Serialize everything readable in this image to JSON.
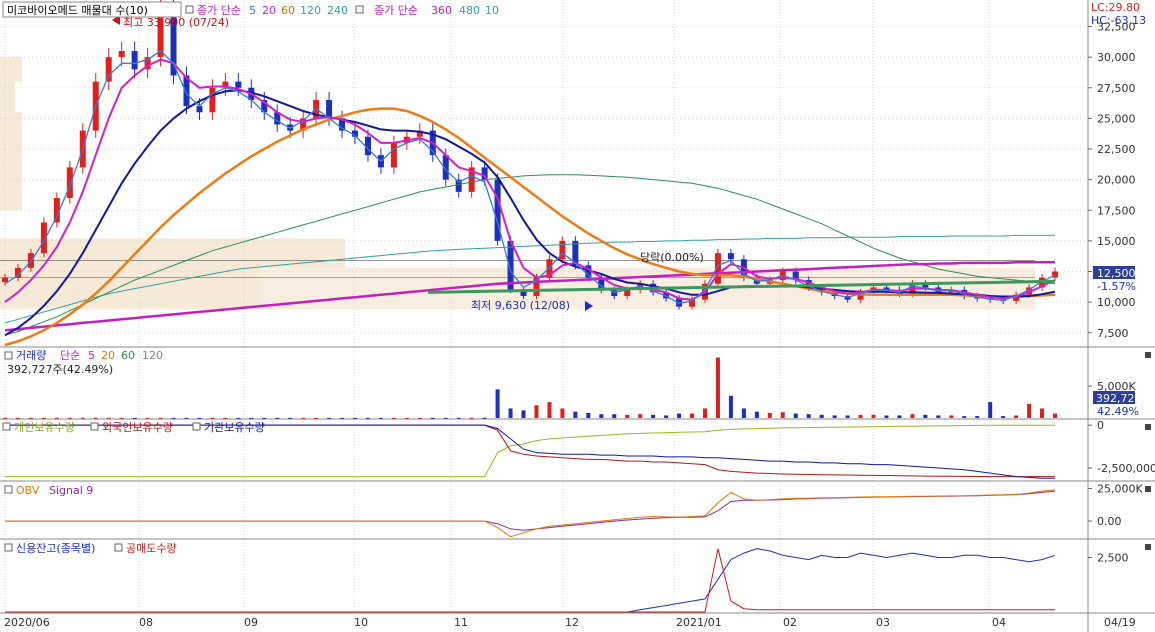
{
  "colors": {
    "up": "#e0201c",
    "down": "#1c2fbf",
    "ma5": "#3d78d8",
    "ma20": "#d41fc9",
    "ma60": "#12169e",
    "ma120": "#f07a15",
    "ma240": "#2c8d52",
    "ma360": "#c31ec2",
    "ma480": "#2fa0a3",
    "volume_band": "#f6e9d6",
    "grid": "#d8d8d8",
    "value_box": "#2c3e9a"
  },
  "header": {
    "stock_title": "미코바이오메드 매물대 수(10)",
    "ma_prefix": "종가 단순",
    "ma_periods": [
      "5",
      "20",
      "60",
      "120",
      "240"
    ],
    "ma2_prefix": "종가 단순",
    "ma2_periods": [
      "360",
      "480",
      "10"
    ]
  },
  "panels": {
    "price": {
      "lc_label": "LC:29.80",
      "hc_label": "HC:-63.13",
      "current_value": "12,500",
      "current_change": "-1.57%",
      "high_annotation": "최고 33,900 (07/24)",
      "low_annotation": "최저 9,630 (12/08)",
      "percent_annotation": "당락(0.00%)",
      "y_ticks": [
        "32,500",
        "30,000",
        "27,500",
        "25,000",
        "22,500",
        "20,000",
        "17,500",
        "15,000",
        "12,500",
        "10,000",
        "7,500"
      ]
    },
    "volume": {
      "title": "거래량",
      "ma_prefix": "단순",
      "ma_periods": [
        "5",
        "20",
        "60",
        "120"
      ],
      "last_value_text": "392,727주(42.49%)",
      "box_value": "392,727",
      "box_pct": "42.49%",
      "y_ticks": [
        "5,000K"
      ]
    },
    "holders": {
      "series": [
        "개인보유수량",
        "외국인보유수량",
        "기관보유수량"
      ],
      "y_ticks": [
        "0",
        "-2,500,000"
      ]
    },
    "obv": {
      "series": [
        "OBV",
        "Signal 9"
      ],
      "y_ticks": [
        "25,000K",
        "0.00"
      ]
    },
    "credit": {
      "series": [
        "신용잔고(종목별)",
        "공매도수량"
      ],
      "y_ticks": [
        "2,500"
      ]
    }
  },
  "x_axis": {
    "labels": [
      "2020/06",
      "08",
      "09",
      "10",
      "11",
      "12",
      "2021/01",
      "02",
      "03",
      "04",
      "04/19"
    ]
  },
  "chart_data": {
    "type": "candlestick",
    "x_range": [
      "2020/06",
      "2021/04/19"
    ],
    "price_ylim": [
      6500,
      34500
    ],
    "price_close": [
      12000,
      12800,
      14000,
      16500,
      18500,
      21000,
      24000,
      28000,
      30000,
      30500,
      29000,
      30000,
      33900,
      28500,
      26000,
      25500,
      27500,
      28000,
      27500,
      26500,
      25500,
      24500,
      24000,
      25000,
      26500,
      25000,
      24000,
      23500,
      22000,
      21000,
      23000,
      23500,
      24000,
      22000,
      20000,
      19000,
      21000,
      20000,
      15000,
      11000,
      10500,
      12000,
      13500,
      15000,
      13000,
      12000,
      11000,
      10500,
      11000,
      11500,
      10800,
      10300,
      9630,
      10200,
      11500,
      14000,
      13500,
      12000,
      11500,
      11800,
      12500,
      11800,
      11200,
      10800,
      10500,
      10200,
      10800,
      11200,
      11000,
      10700,
      11500,
      11200,
      10800,
      11000,
      10500,
      10300,
      10200,
      10100,
      10600,
      11200,
      12000,
      12500
    ],
    "ma5": [
      11500,
      12200,
      13300,
      15000,
      17000,
      19500,
      22500,
      26000,
      28500,
      29500,
      29500,
      29800,
      30500,
      29500,
      27000,
      26000,
      27000,
      27500,
      27200,
      26500,
      25500,
      24800,
      24200,
      24800,
      25800,
      25000,
      24200,
      23600,
      22500,
      21500,
      22500,
      23000,
      23300,
      22300,
      20800,
      19800,
      20300,
      19800,
      16500,
      12500,
      11200,
      11800,
      12800,
      14000,
      13200,
      12200,
      11300,
      10800,
      11000,
      11300,
      10900,
      10500,
      9900,
      10100,
      11000,
      13000,
      13400,
      12300,
      11700,
      11800,
      12200,
      11800,
      11300,
      10900,
      10600,
      10400,
      10700,
      11000,
      10950,
      10800,
      11300,
      11150,
      10900,
      10950,
      10650,
      10400,
      10250,
      10150,
      10500,
      11000,
      11700,
      12200
    ],
    "ma20": [
      10000,
      10800,
      11800,
      13000,
      14500,
      16500,
      19000,
      22000,
      25000,
      27500,
      28500,
      29300,
      29800,
      29500,
      28300,
      27500,
      27600,
      27600,
      27400,
      27000,
      26300,
      25500,
      24900,
      24700,
      25000,
      25100,
      24900,
      24500,
      23800,
      23000,
      23000,
      23200,
      23400,
      23000,
      22000,
      21000,
      20700,
      20300,
      18500,
      15000,
      12800,
      12000,
      12200,
      13000,
      13200,
      12700,
      12000,
      11400,
      11100,
      11200,
      11000,
      10800,
      10300,
      10200,
      10800,
      12300,
      13100,
      12800,
      12100,
      11900,
      12000,
      11900,
      11600,
      11200,
      10900,
      10700,
      10800,
      11000,
      11000,
      10900,
      11100,
      11100,
      11000,
      10980,
      10800,
      10600,
      10400,
      10300,
      10450,
      10800,
      11300,
      11800
    ],
    "ma60": [
      7300,
      7900,
      8700,
      9700,
      10900,
      12300,
      14000,
      15900,
      17800,
      19700,
      21300,
      22700,
      24000,
      25000,
      25800,
      26400,
      26900,
      27200,
      27300,
      27100,
      26800,
      26400,
      26000,
      25600,
      25300,
      25100,
      24900,
      24700,
      24400,
      24100,
      24000,
      24000,
      23900,
      23700,
      23300,
      22700,
      22100,
      21400,
      20200,
      18500,
      16700,
      15100,
      14000,
      13300,
      12900,
      12600,
      12300,
      11900,
      11600,
      11500,
      11300,
      11100,
      10800,
      10600,
      10600,
      10900,
      11200,
      11300,
      11300,
      11300,
      11300,
      11300,
      11200,
      11100,
      11000,
      10900,
      10850,
      10850,
      10850,
      10800,
      10800,
      10780,
      10750,
      10700,
      10650,
      10600,
      10500,
      10450,
      10450,
      10500,
      10650,
      10850
    ],
    "ma120": [
      6500,
      6800,
      7200,
      7700,
      8300,
      9000,
      9800,
      10700,
      11700,
      12800,
      13900,
      15000,
      16100,
      17100,
      18000,
      18900,
      19700,
      20500,
      21200,
      21900,
      22500,
      23100,
      23600,
      24100,
      24500,
      24900,
      25200,
      25500,
      25700,
      25800,
      25800,
      25600,
      25200,
      24700,
      24100,
      23400,
      22600,
      21800,
      21000,
      20200,
      19400,
      18600,
      17800,
      17000,
      16300,
      15600,
      15000,
      14400,
      13900,
      13500,
      13100,
      12800,
      12500,
      12300,
      12200,
      12200,
      12200,
      12100,
      11900,
      11700,
      11500,
      11300,
      11100,
      10900,
      10800,
      10700,
      10650,
      10600,
      10600,
      10600,
      10600,
      10600,
      10600,
      10600,
      10550,
      10500,
      10450,
      10450,
      10450,
      10500,
      10550,
      10600
    ],
    "ma240": [
      7300,
      7600,
      8000,
      8400,
      8800,
      9300,
      9800,
      10300,
      10800,
      11300,
      11800,
      12200,
      12600,
      13000,
      13400,
      13800,
      14200,
      14500,
      14800,
      15100,
      15400,
      15700,
      16000,
      16300,
      16600,
      16900,
      17200,
      17500,
      17800,
      18100,
      18400,
      18700,
      19000,
      19200,
      19400,
      19600,
      19800,
      20000,
      20100,
      20200,
      20300,
      20350,
      20400,
      20400,
      20400,
      20350,
      20300,
      20250,
      20200,
      20100,
      20000,
      19900,
      19800,
      19700,
      19500,
      19300,
      19000,
      18700,
      18400,
      18000,
      17600,
      17200,
      16800,
      16400,
      15900,
      15400,
      14900,
      14400,
      14000,
      13600,
      13300,
      13000,
      12700,
      12500,
      12300,
      12100,
      12000,
      11900,
      11800,
      11700,
      11600,
      11500
    ],
    "ma360": [
      7700,
      7800,
      7900,
      8000,
      8100,
      8200,
      8300,
      8400,
      8500,
      8600,
      8700,
      8800,
      8900,
      9000,
      9100,
      9200,
      9300,
      9400,
      9500,
      9600,
      9700,
      9800,
      9900,
      10000,
      10100,
      10200,
      10300,
      10400,
      10500,
      10600,
      10700,
      10800,
      10900,
      11000,
      11100,
      11200,
      11300,
      11400,
      11500,
      11550,
      11600,
      11650,
      11700,
      11750,
      11800,
      11850,
      11900,
      11950,
      12000,
      12050,
      12100,
      12150,
      12200,
      12250,
      12300,
      12350,
      12400,
      12450,
      12500,
      12550,
      12600,
      12650,
      12700,
      12750,
      12800,
      12850,
      12900,
      12950,
      13000,
      13050,
      13100,
      13100,
      13150,
      13150,
      13200,
      13200,
      13200,
      13200,
      13250,
      13250,
      13250,
      13250
    ],
    "ma480": [
      8300,
      8600,
      8900,
      9200,
      9500,
      9800,
      10100,
      10400,
      10700,
      10900,
      11100,
      11300,
      11500,
      11700,
      11900,
      12100,
      12300,
      12500,
      12700,
      12800,
      12900,
      13000,
      13100,
      13200,
      13300,
      13400,
      13500,
      13600,
      13700,
      13800,
      13900,
      14000,
      14100,
      14200,
      14250,
      14300,
      14350,
      14400,
      14450,
      14500,
      14550,
      14600,
      14650,
      14700,
      14750,
      14800,
      14850,
      14900,
      14900,
      14950,
      14950,
      15000,
      15000,
      15050,
      15050,
      15100,
      15100,
      15150,
      15150,
      15200,
      15200,
      15200,
      15250,
      15250,
      15250,
      15300,
      15300,
      15300,
      15300,
      15350,
      15350,
      15350,
      15350,
      15400,
      15400,
      15400,
      15400,
      15400,
      15450,
      15450,
      15450,
      15450
    ],
    "volume_profile": [
      0,
      0,
      0,
      0,
      0,
      0,
      0,
      0,
      0,
      0
    ],
    "volume_k": [
      20,
      20,
      30,
      30,
      25,
      30,
      40,
      35,
      30,
      25,
      20,
      25,
      35,
      25,
      20,
      20,
      25,
      20,
      20,
      15,
      15,
      15,
      15,
      20,
      20,
      15,
      15,
      15,
      20,
      15,
      15,
      15,
      15,
      20,
      25,
      20,
      20,
      40,
      4500,
      1500,
      1200,
      2000,
      2500,
      1500,
      1000,
      800,
      600,
      600,
      500,
      600,
      500,
      400,
      700,
      700,
      1500,
      9500,
      3500,
      1500,
      1000,
      800,
      900,
      700,
      600,
      500,
      400,
      400,
      500,
      500,
      400,
      400,
      600,
      500,
      400,
      400,
      300,
      300,
      2500,
      300,
      400,
      2200,
      1500,
      700
    ],
    "volume_ylim": [
      0,
      11000
    ],
    "holders_individual": [
      -3000000,
      -3000000,
      -3000000,
      -3000000,
      -3000000,
      -3000000,
      -3000000,
      -3000000,
      -3000000,
      -3000000,
      -3000000,
      -3000000,
      -3000000,
      -3000000,
      -3000000,
      -3000000,
      -3000000,
      -3000000,
      -3000000,
      -3000000,
      -3000000,
      -3000000,
      -3000000,
      -3000000,
      -3000000,
      -3000000,
      -3000000,
      -3000000,
      -3000000,
      -3000000,
      -3000000,
      -3000000,
      -3000000,
      -3000000,
      -3000000,
      -3000000,
      -3000000,
      -3000000,
      -1600000,
      -1200000,
      -1100000,
      -900000,
      -800000,
      -750000,
      -700000,
      -650000,
      -600000,
      -550000,
      -500000,
      -480000,
      -460000,
      -440000,
      -420000,
      -400000,
      -380000,
      -300000,
      -250000,
      -220000,
      -200000,
      -180000,
      -160000,
      -150000,
      -140000,
      -130000,
      -120000,
      -110000,
      -100000,
      -90000,
      -80000,
      -70000,
      -60000,
      -50000,
      -40000,
      -30000,
      -20000,
      -15000,
      -10000,
      -8000,
      -6000,
      -4000,
      -2000,
      -1000
    ],
    "holders_foreign": [
      0,
      0,
      0,
      0,
      0,
      0,
      0,
      0,
      0,
      0,
      0,
      0,
      0,
      0,
      0,
      0,
      0,
      0,
      0,
      0,
      0,
      0,
      0,
      0,
      0,
      0,
      0,
      0,
      0,
      0,
      0,
      0,
      0,
      0,
      0,
      0,
      0,
      0,
      -300000,
      -1500000,
      -1700000,
      -1800000,
      -1850000,
      -1900000,
      -1950000,
      -2000000,
      -2000000,
      -2050000,
      -2100000,
      -2100000,
      -2150000,
      -2150000,
      -2200000,
      -2250000,
      -2300000,
      -2600000,
      -2700000,
      -2750000,
      -2800000,
      -2820000,
      -2850000,
      -2870000,
      -2880000,
      -2890000,
      -2900000,
      -2910000,
      -2920000,
      -2930000,
      -2940000,
      -2950000,
      -2960000,
      -2970000,
      -2980000,
      -2985000,
      -2990000,
      -2995000,
      -3000000,
      -3000000,
      -3000000,
      -3000000,
      -3000000,
      -3000000
    ],
    "holders_institution": [
      0,
      0,
      0,
      0,
      0,
      0,
      0,
      0,
      0,
      0,
      0,
      0,
      0,
      0,
      0,
      0,
      0,
      0,
      0,
      0,
      0,
      0,
      0,
      0,
      0,
      0,
      0,
      0,
      0,
      0,
      0,
      0,
      0,
      0,
      0,
      0,
      0,
      0,
      -200000,
      -800000,
      -1400000,
      -1600000,
      -1650000,
      -1700000,
      -1700000,
      -1700000,
      -1750000,
      -1750000,
      -1800000,
      -1800000,
      -1800000,
      -1850000,
      -1850000,
      -1850000,
      -1900000,
      -1900000,
      -1950000,
      -2000000,
      -2050000,
      -2100000,
      -2100000,
      -2150000,
      -2150000,
      -2200000,
      -2200000,
      -2250000,
      -2250000,
      -2300000,
      -2300000,
      -2350000,
      -2400000,
      -2450000,
      -2500000,
      -2550000,
      -2600000,
      -2700000,
      -2800000,
      -2900000,
      -3000000,
      -3050000,
      -3100000,
      -3100000
    ],
    "holders_ylim": [
      -3200000,
      300000
    ],
    "obv_k": [
      0,
      0,
      0,
      0,
      0,
      0,
      0,
      0,
      0,
      0,
      0,
      0,
      0,
      0,
      0,
      0,
      0,
      0,
      0,
      0,
      0,
      0,
      0,
      0,
      0,
      0,
      0,
      0,
      0,
      0,
      0,
      0,
      0,
      0,
      0,
      0,
      0,
      0,
      -5000,
      -12000,
      -9000,
      -6000,
      -4000,
      -3000,
      -2000,
      -1000,
      0,
      1000,
      2000,
      3000,
      3500,
      3200,
      3000,
      3500,
      4000,
      14000,
      22000,
      17000,
      16000,
      16500,
      17000,
      17500,
      17500,
      17800,
      18000,
      18200,
      18500,
      18600,
      18700,
      18800,
      19000,
      19100,
      19200,
      19300,
      19500,
      19700,
      20000,
      20200,
      20500,
      21500,
      23000,
      24000
    ],
    "obv_signal_k": [
      0,
      0,
      0,
      0,
      0,
      0,
      0,
      0,
      0,
      0,
      0,
      0,
      0,
      0,
      0,
      0,
      0,
      0,
      0,
      0,
      0,
      0,
      0,
      0,
      0,
      0,
      0,
      0,
      0,
      0,
      0,
      0,
      0,
      0,
      0,
      0,
      0,
      0,
      -2000,
      -6000,
      -7000,
      -6000,
      -5000,
      -4000,
      -3000,
      -2000,
      -1000,
      0,
      800,
      1500,
      2200,
      2600,
      2800,
      3000,
      3200,
      8000,
      15000,
      16000,
      16000,
      16200,
      16500,
      17000,
      17200,
      17500,
      17700,
      17900,
      18200,
      18400,
      18500,
      18600,
      18800,
      18900,
      19000,
      19100,
      19300,
      19500,
      19700,
      20000,
      20300,
      21000,
      22000,
      23000
    ],
    "obv_ylim": [
      -13000,
      30000
    ],
    "credit_balance": [
      0,
      0,
      0,
      0,
      0,
      0,
      0,
      0,
      0,
      0,
      0,
      0,
      0,
      0,
      0,
      0,
      0,
      0,
      0,
      0,
      0,
      0,
      0,
      0,
      0,
      0,
      0,
      0,
      0,
      0,
      0,
      0,
      0,
      0,
      0,
      0,
      0,
      0,
      0,
      0,
      0,
      0,
      0,
      0,
      0,
      0,
      0,
      0,
      0,
      100,
      200,
      300,
      400,
      500,
      600,
      1500,
      2400,
      2700,
      2900,
      2800,
      2600,
      2500,
      2400,
      2600,
      2500,
      2500,
      2700,
      2600,
      2500,
      2600,
      2700,
      2600,
      2500,
      2500,
      2600,
      2600,
      2500,
      2500,
      2400,
      2300,
      2400,
      2600
    ],
    "short_selling": [
      0,
      0,
      0,
      0,
      0,
      0,
      0,
      0,
      0,
      0,
      0,
      0,
      0,
      0,
      0,
      0,
      0,
      0,
      0,
      0,
      0,
      0,
      0,
      0,
      0,
      0,
      0,
      0,
      0,
      0,
      0,
      0,
      0,
      0,
      0,
      0,
      0,
      0,
      0,
      0,
      0,
      0,
      0,
      0,
      0,
      0,
      0,
      0,
      0,
      0,
      0,
      0,
      0,
      0,
      0,
      2900,
      500,
      150,
      100,
      100,
      100,
      100,
      100,
      100,
      100,
      100,
      100,
      100,
      100,
      100,
      100,
      100,
      100,
      100,
      100,
      100,
      100,
      100,
      100,
      100,
      100,
      100
    ],
    "credit_ylim": [
      0,
      3300
    ]
  }
}
